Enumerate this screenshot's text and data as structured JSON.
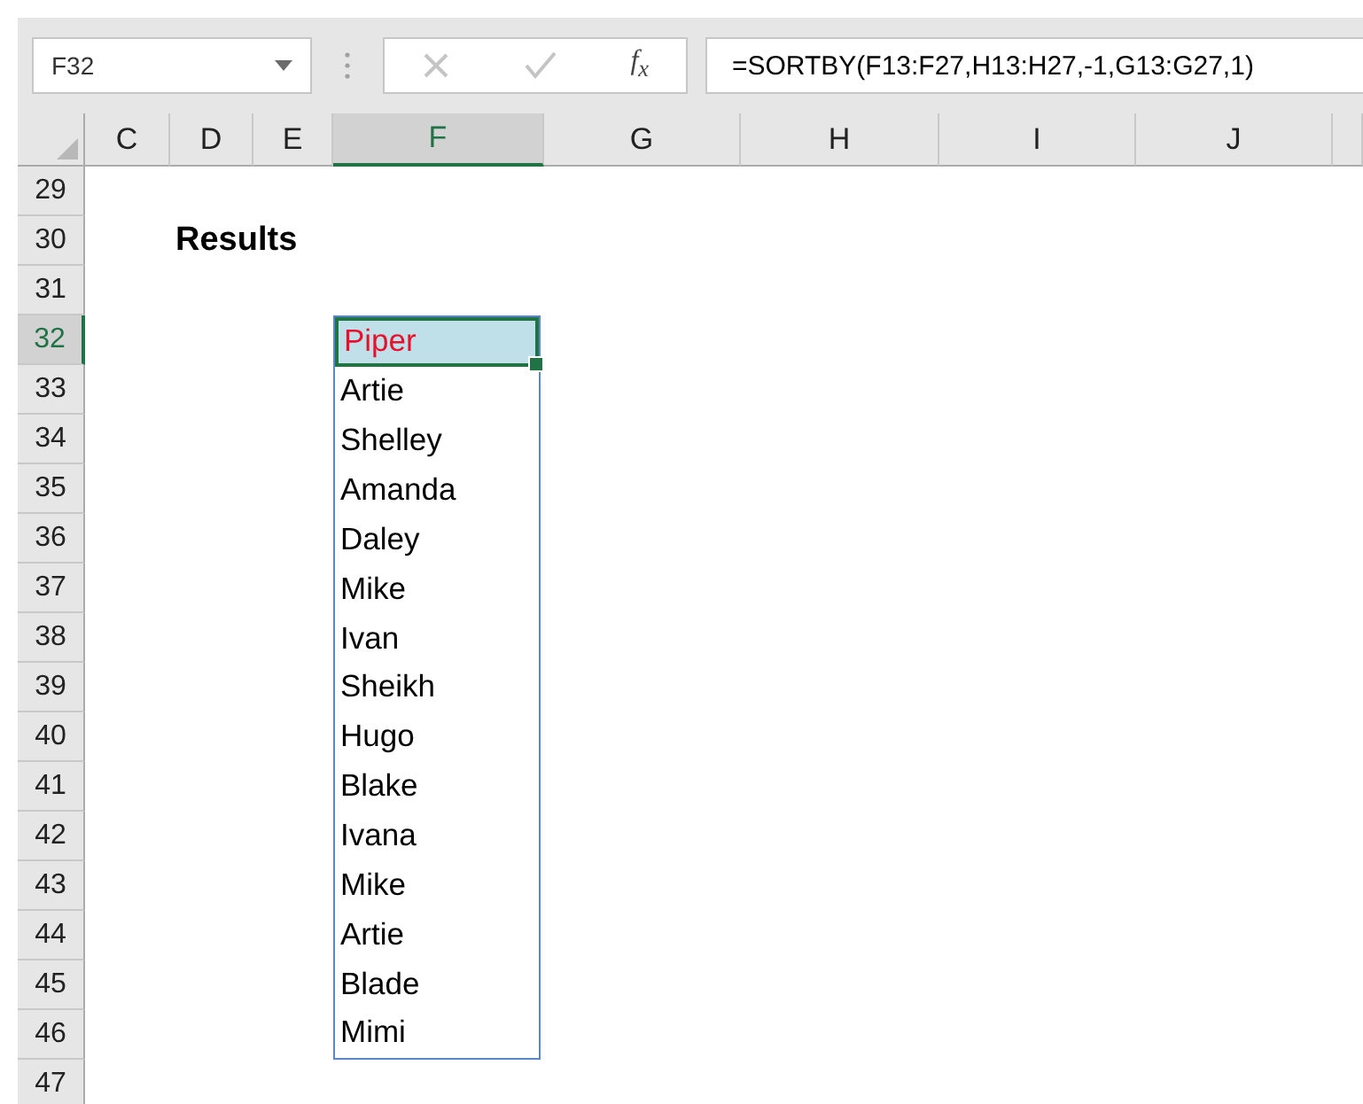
{
  "name_box": {
    "value": "F32"
  },
  "formula_bar": {
    "fx_label": "f$_{x}$",
    "value": "=SORTBY(F13:F27,H13:H27,-1,G13:G27,1)"
  },
  "columns": [
    {
      "label": "C",
      "selected": false
    },
    {
      "label": "D",
      "selected": false
    },
    {
      "label": "E",
      "selected": false
    },
    {
      "label": "F",
      "selected": true
    },
    {
      "label": "G",
      "selected": false
    },
    {
      "label": "H",
      "selected": false
    },
    {
      "label": "I",
      "selected": false
    },
    {
      "label": "J",
      "selected": false
    }
  ],
  "rows": [
    {
      "label": "29",
      "selected": false
    },
    {
      "label": "30",
      "selected": false
    },
    {
      "label": "31",
      "selected": false
    },
    {
      "label": "32",
      "selected": true
    },
    {
      "label": "33",
      "selected": false
    },
    {
      "label": "34",
      "selected": false
    },
    {
      "label": "35",
      "selected": false
    },
    {
      "label": "36",
      "selected": false
    },
    {
      "label": "37",
      "selected": false
    },
    {
      "label": "38",
      "selected": false
    },
    {
      "label": "39",
      "selected": false
    },
    {
      "label": "40",
      "selected": false
    },
    {
      "label": "41",
      "selected": false
    },
    {
      "label": "42",
      "selected": false
    },
    {
      "label": "43",
      "selected": false
    },
    {
      "label": "44",
      "selected": false
    },
    {
      "label": "45",
      "selected": false
    },
    {
      "label": "46",
      "selected": false
    },
    {
      "label": "47",
      "selected": false
    }
  ],
  "heading": "Results",
  "results": [
    {
      "value": "Piper",
      "selected": true,
      "color": "#e8112d"
    },
    {
      "value": "Artie",
      "selected": false,
      "color": "#000000"
    },
    {
      "value": "Shelley",
      "selected": false,
      "color": "#000000"
    },
    {
      "value": "Amanda",
      "selected": false,
      "color": "#000000"
    },
    {
      "value": "Daley",
      "selected": false,
      "color": "#000000"
    },
    {
      "value": "Mike",
      "selected": false,
      "color": "#000000"
    },
    {
      "value": "Ivan",
      "selected": false,
      "color": "#000000"
    },
    {
      "value": "Sheikh",
      "selected": false,
      "color": "#000000"
    },
    {
      "value": "Hugo",
      "selected": false,
      "color": "#000000"
    },
    {
      "value": "Blake",
      "selected": false,
      "color": "#000000"
    },
    {
      "value": "Ivana",
      "selected": false,
      "color": "#000000"
    },
    {
      "value": "Mike",
      "selected": false,
      "color": "#000000"
    },
    {
      "value": "Artie",
      "selected": false,
      "color": "#000000"
    },
    {
      "value": "Blade",
      "selected": false,
      "color": "#000000"
    },
    {
      "value": "Mimi",
      "selected": false,
      "color": "#000000"
    }
  ]
}
